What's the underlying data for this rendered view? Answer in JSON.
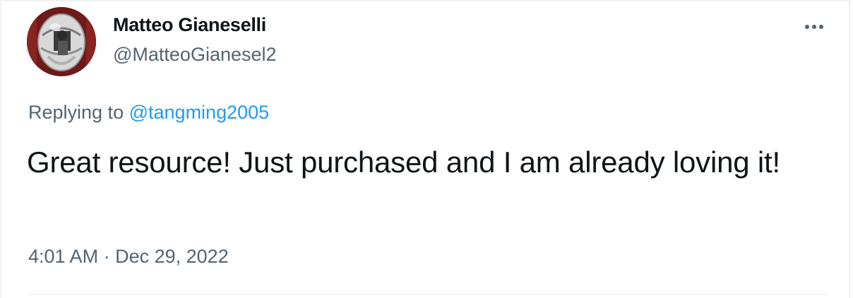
{
  "tweet": {
    "author": {
      "display_name": "Matteo Gianeselli",
      "handle": "@MatteoGianesel2",
      "avatar_icon": "profile-photo-reflective-sphere"
    },
    "more_icon": "more-horizontal-icon",
    "reply": {
      "prefix": "Replying to",
      "handle": "@tangming2005"
    },
    "text": "Great resource! Just purchased and I am already loving it!",
    "meta": {
      "time": "4:01 AM",
      "separator": "·",
      "date": "Dec 29, 2022"
    }
  },
  "colors": {
    "primary_text": "#0f1419",
    "secondary_text": "#536471",
    "link": "#1d9bf0",
    "border": "#eff3f4"
  }
}
